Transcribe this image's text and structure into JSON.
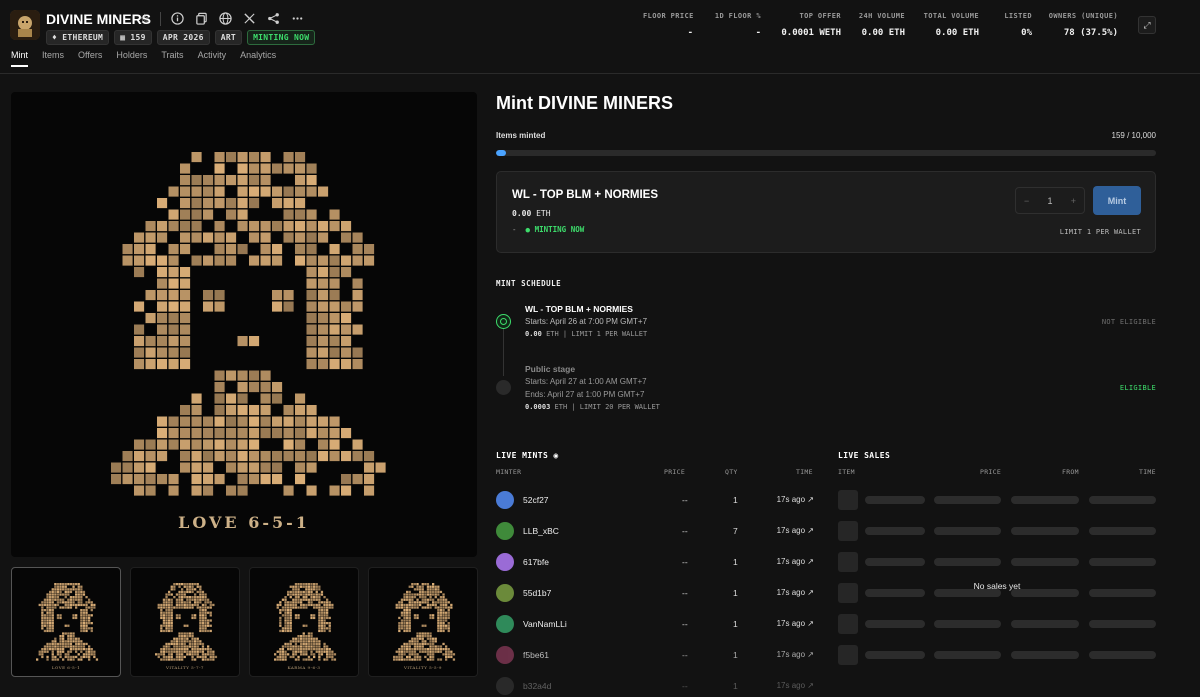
{
  "header": {
    "title": "DIVINE MINERS",
    "badges": {
      "chain": "ETHEREUM",
      "count": "159",
      "date": "APR 2026",
      "category": "ART",
      "status": "MINTING NOW"
    },
    "tabs": [
      "Mint",
      "Items",
      "Offers",
      "Holders",
      "Traits",
      "Activity",
      "Analytics"
    ],
    "active_tab": "Mint",
    "stats": [
      {
        "label": "FLOOR PRICE",
        "value": "-"
      },
      {
        "label": "1D FLOOR %",
        "value": "-"
      },
      {
        "label": "TOP OFFER",
        "value": "0.0001 WETH"
      },
      {
        "label": "24H VOLUME",
        "value": "0.00 ETH"
      },
      {
        "label": "TOTAL VOLUME",
        "value": "0.00 ETH"
      },
      {
        "label": "LISTED",
        "value": "0%"
      },
      {
        "label": "OWNERS (UNIQUE)",
        "value": "78 (37.5%)"
      }
    ]
  },
  "art": {
    "caption": "LOVE 6-5-1",
    "thumbs": [
      {
        "caption": "LOVE 6-5-1"
      },
      {
        "caption": "VITALITY 5-7-7"
      },
      {
        "caption": "KARMA 9-6-3"
      },
      {
        "caption": "VITALITY 5-5-9"
      }
    ]
  },
  "mint": {
    "title": "Mint DIVINE MINERS",
    "minted_label": "Items minted",
    "minted_count": "159 / 10,000",
    "progress_fraction": 0.0159,
    "stage": {
      "name": "WL - TOP BLM + NORMIES",
      "price": "0.00",
      "currency": "ETH",
      "dash": "-",
      "status": "MINTING NOW",
      "qty": "1",
      "qty_minus": "−",
      "qty_plus": "+",
      "button": "Mint",
      "limit": "LIMIT 1 PER WALLET"
    }
  },
  "schedule": {
    "title": "MINT SCHEDULE",
    "stages": [
      {
        "name": "WL - TOP BLM + NORMIES",
        "starts": "Starts: April 26 at 7:00 PM GMT+7",
        "price": "0.00",
        "meta": "ETH | LIMIT 1 PER WALLET",
        "eligibility": "NOT ELIGIBLE",
        "eligibility_color": "#6e6e6e"
      },
      {
        "name": "Public stage",
        "starts": "Starts: April 27 at 1:00 AM GMT+7",
        "ends": "Ends: April 27 at 1:00 PM GMT+7",
        "price": "0.0003",
        "meta": "ETH | LIMIT 20 PER WALLET",
        "eligibility": "ELIGIBLE",
        "eligibility_color": "#3ddc6b"
      }
    ]
  },
  "live_mints": {
    "title": "LIVE MINTS",
    "columns": [
      "MINTER",
      "PRICE",
      "QTY",
      "TIME"
    ],
    "rows": [
      {
        "minter": "52cf27",
        "price": "--",
        "qty": "1",
        "time": "17s ago ↗",
        "avatar": "#4a7bd6"
      },
      {
        "minter": "LLB_xBC",
        "price": "--",
        "qty": "7",
        "time": "17s ago ↗",
        "avatar": "#3f8a3a"
      },
      {
        "minter": "617bfe",
        "price": "--",
        "qty": "1",
        "time": "17s ago ↗",
        "avatar": "#9a6bd6"
      },
      {
        "minter": "55d1b7",
        "price": "--",
        "qty": "1",
        "time": "17s ago ↗",
        "avatar": "#6b8a3a"
      },
      {
        "minter": "VanNamLLi",
        "price": "--",
        "qty": "1",
        "time": "17s ago ↗",
        "avatar": "#2f8a5a"
      },
      {
        "minter": "f5be61",
        "price": "--",
        "qty": "1",
        "time": "17s ago ↗",
        "avatar": "#8a3a5a"
      },
      {
        "minter": "b32a4d",
        "price": "--",
        "qty": "1",
        "time": "17s ago ↗",
        "avatar": "#555555"
      }
    ]
  },
  "live_sales": {
    "title": "LIVE SALES",
    "columns": [
      "ITEM",
      "PRICE",
      "FROM",
      "TIME"
    ],
    "empty": "No sales yet"
  }
}
